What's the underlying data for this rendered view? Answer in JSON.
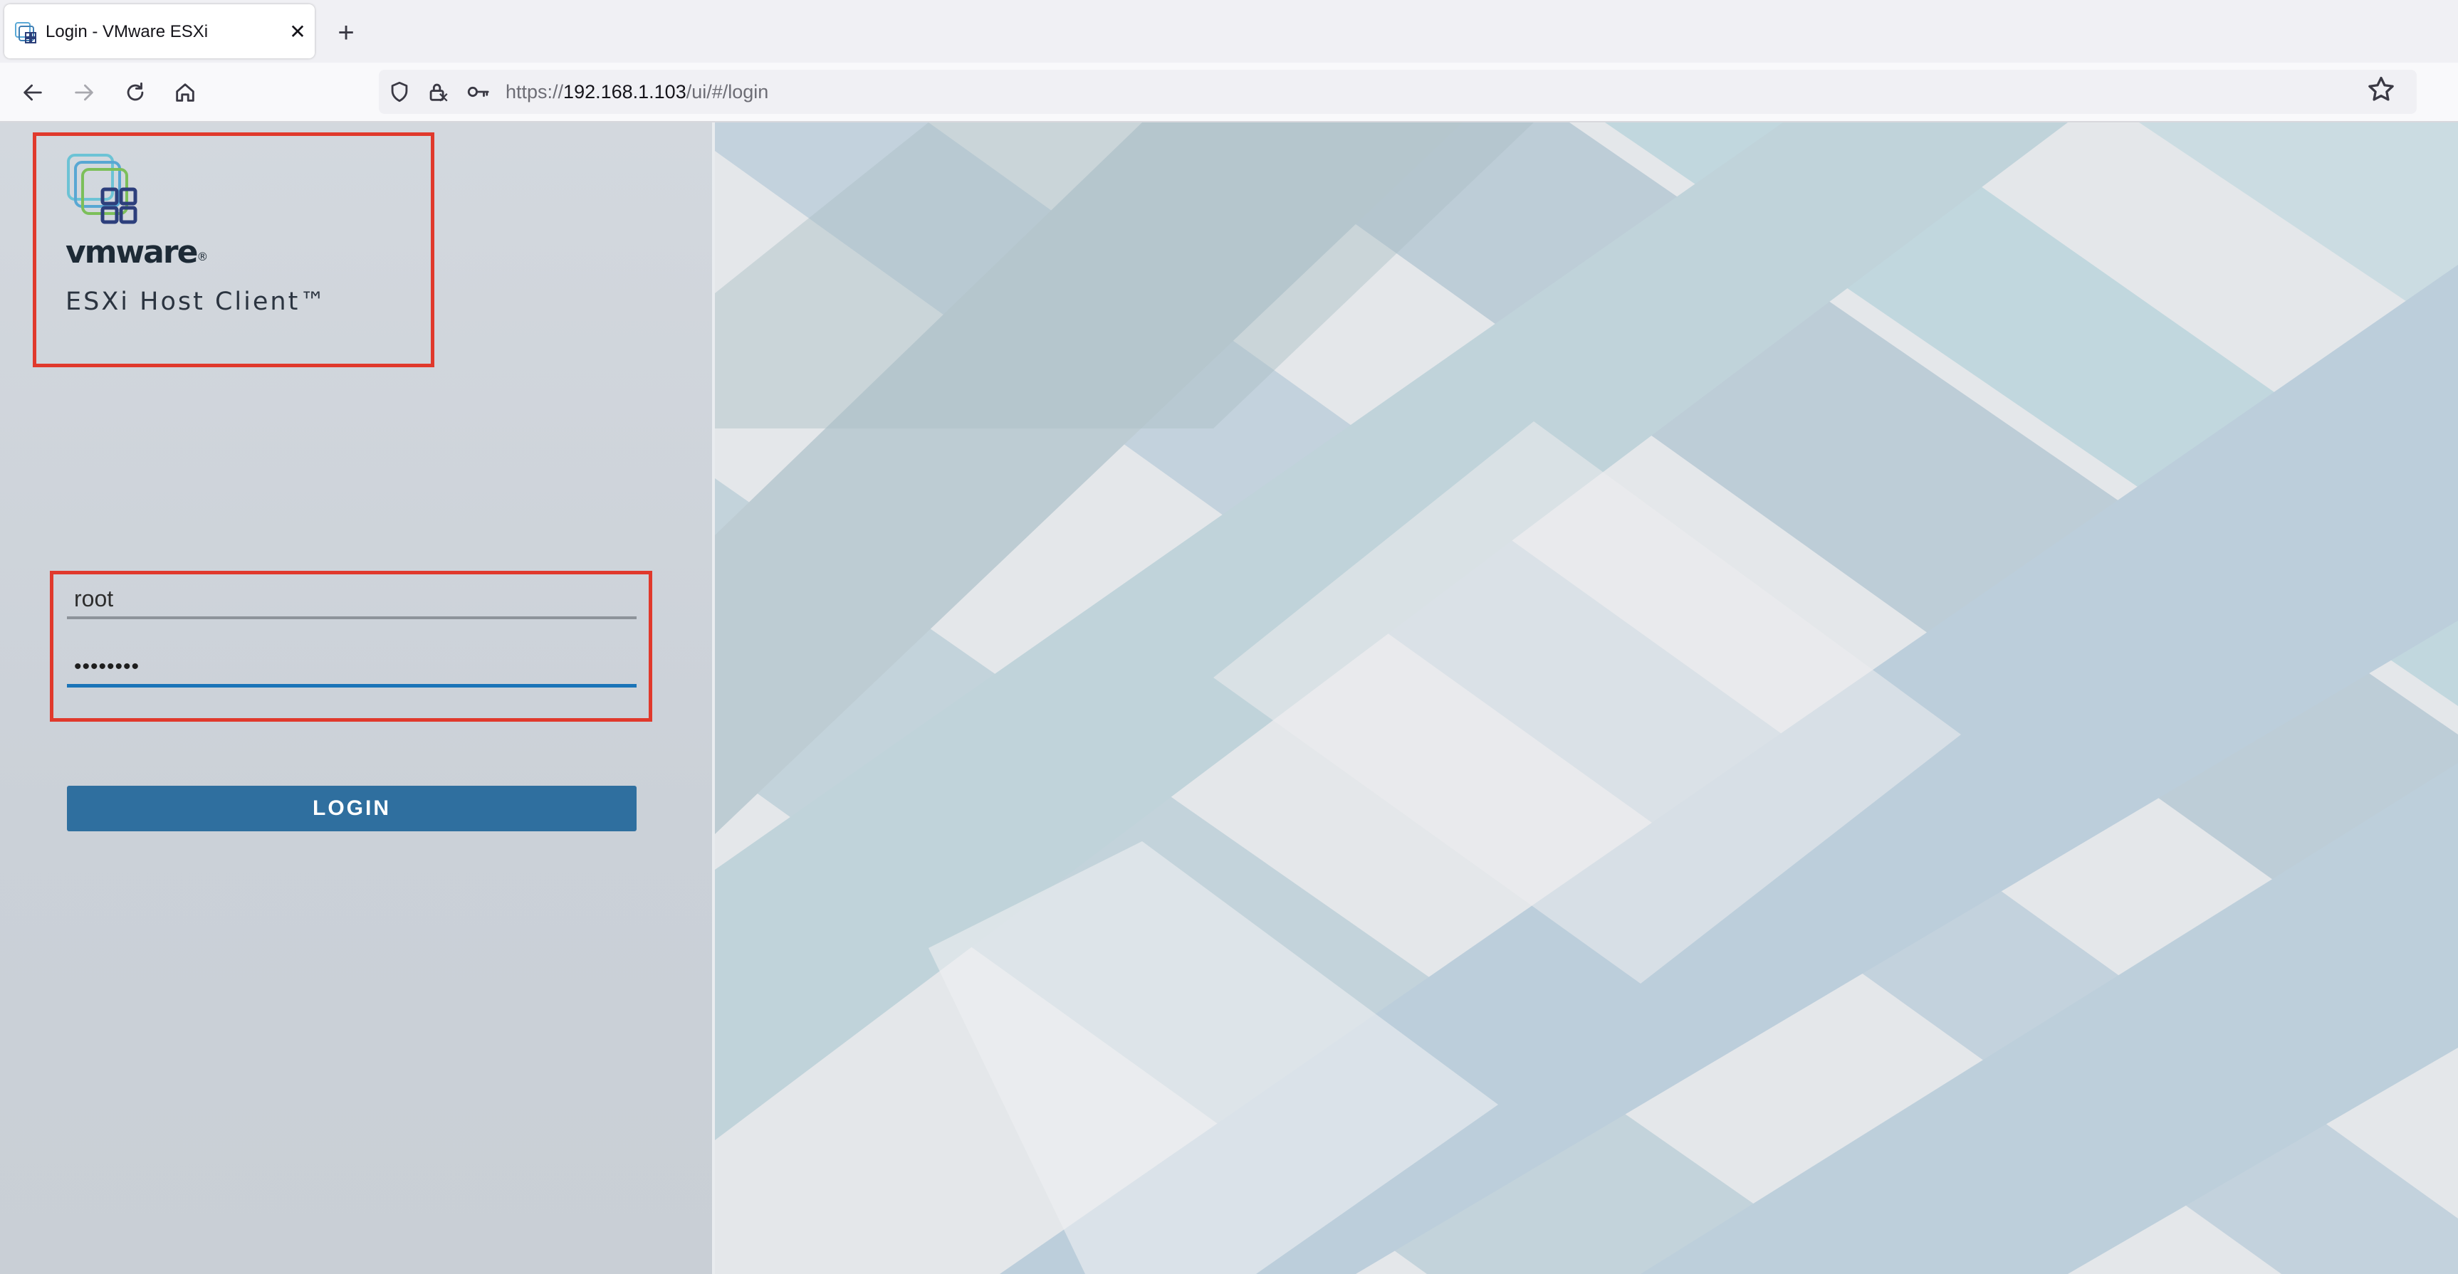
{
  "browser": {
    "tab": {
      "title": "Login - VMware ESXi",
      "close_glyph": "✕"
    },
    "new_tab_glyph": "+",
    "toolbar": {
      "back_icon": "back-arrow-icon",
      "forward_icon": "forward-arrow-icon",
      "reload_icon": "reload-icon",
      "home_icon": "home-icon"
    },
    "url": {
      "scheme": "https://",
      "host": "192.168.1.103",
      "path": "/ui/#/login"
    },
    "bookmark_icon": "star-icon"
  },
  "login": {
    "brand": {
      "wordmark": "vmware",
      "registered": "®",
      "product": "ESXi Host Client™"
    },
    "username": {
      "value": "root"
    },
    "password": {
      "value": "••••••••"
    },
    "login_button": "LOGIN"
  },
  "colors": {
    "highlight_border": "#e0392c",
    "login_button": "#2f6f9f",
    "active_field_underline": "#1a74b8"
  }
}
